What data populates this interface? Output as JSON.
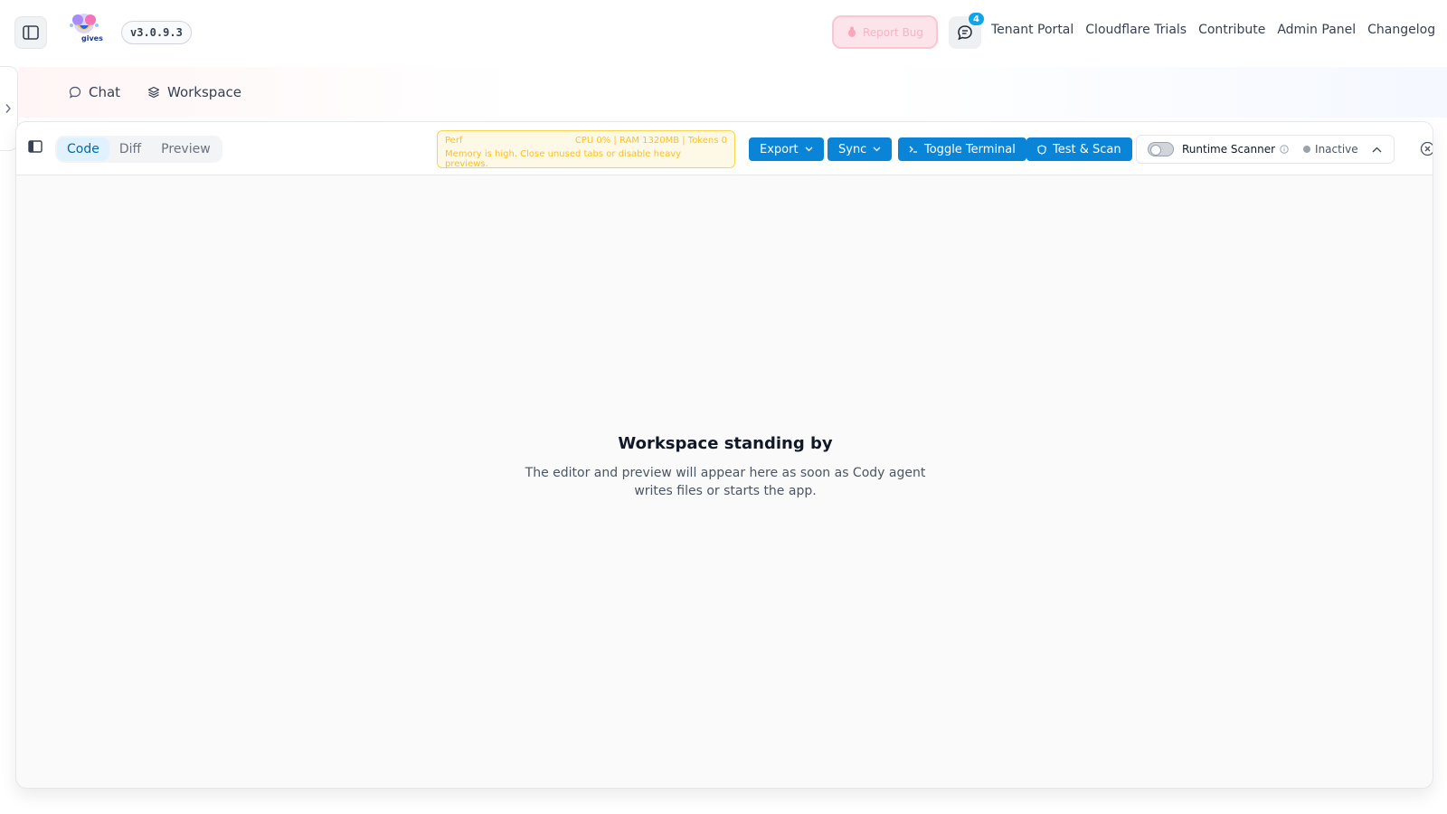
{
  "header": {
    "version": "v3.0.9.3",
    "logo_text": "gives",
    "report_button_label": "Report Bug",
    "notification_count": "4",
    "links": [
      "Tenant Portal",
      "Cloudflare Trials",
      "Contribute",
      "Admin Panel",
      "Changelog"
    ]
  },
  "tabs": {
    "chat_label": "Chat",
    "workspace_label": "Workspace"
  },
  "workspace": {
    "view_tabs": [
      "Code",
      "Diff",
      "Preview"
    ],
    "active_view": "Code",
    "perf": {
      "label": "Perf",
      "stats": "CPU 0% | RAM 1320MB | Tokens 0",
      "warning": "Memory is high. Close unused tabs or disable heavy previews."
    },
    "actions": {
      "export_label": "Export",
      "sync_label": "Sync",
      "terminal_label": "Toggle Terminal",
      "test_scan_label": "Test & Scan"
    },
    "scanner": {
      "label": "Runtime Scanner",
      "status": "Inactive"
    },
    "empty_state": {
      "title": "Workspace standing by",
      "description": "The editor and preview will appear here as soon as Cody agent writes files or starts the app."
    }
  },
  "colors": {
    "primary_button": "#0a84d6",
    "active_tab": "#e0f2fe",
    "perf_warning": "#fbbf24"
  }
}
